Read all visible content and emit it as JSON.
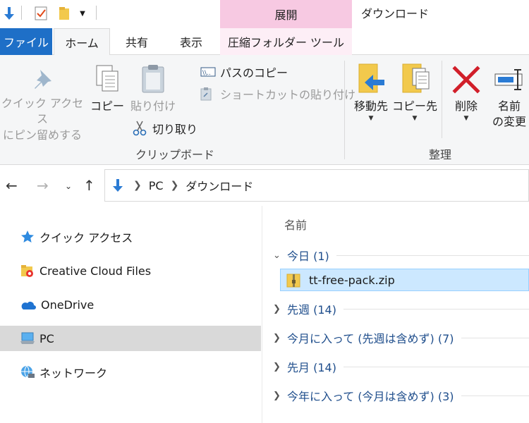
{
  "window": {
    "title": "ダウンロード",
    "context_tab_group": "展開"
  },
  "tabs": {
    "file": "ファイル",
    "home": "ホーム",
    "share": "共有",
    "view": "表示",
    "compressed_tools": "圧縮フォルダー ツール"
  },
  "ribbon": {
    "pin_quick_access": "クイック アクセス\nにピン留めする",
    "copy": "コピー",
    "paste": "貼り付け",
    "copy_path": "パスのコピー",
    "paste_shortcut": "ショートカットの貼り付け",
    "cut": "切り取り",
    "clipboard_group": "クリップボード",
    "move_to": "移動先",
    "copy_to": "コピー先",
    "delete": "削除",
    "rename_line1": "名前",
    "rename_line2": "の変更",
    "organize_group": "整理"
  },
  "address": {
    "crumbs": [
      "PC",
      "ダウンロード"
    ]
  },
  "sidebar": {
    "items": [
      {
        "label": "クイック アクセス",
        "icon": "star-icon"
      },
      {
        "label": "Creative Cloud Files",
        "icon": "creative-cloud-folder-icon"
      },
      {
        "label": "OneDrive",
        "icon": "cloud-icon"
      },
      {
        "label": "PC",
        "icon": "computer-icon",
        "selected": true
      },
      {
        "label": "ネットワーク",
        "icon": "network-icon"
      }
    ]
  },
  "content": {
    "column_name": "名前",
    "groups": [
      {
        "label": "今日 (1)",
        "expanded": true
      },
      {
        "label": "先週 (14)",
        "expanded": false
      },
      {
        "label": "今月に入って (先週は含めず) (7)",
        "expanded": false
      },
      {
        "label": "先月 (14)",
        "expanded": false
      },
      {
        "label": "今年に入って (今月は含めず) (3)",
        "expanded": false
      }
    ],
    "file": {
      "name": "tt-free-pack.zip",
      "icon": "zip-folder-icon"
    }
  },
  "colors": {
    "file_tab": "#1e6fc7",
    "context_tab": "#f7c9e2",
    "selection": "#cce8ff",
    "delete_red": "#d11f2a"
  }
}
